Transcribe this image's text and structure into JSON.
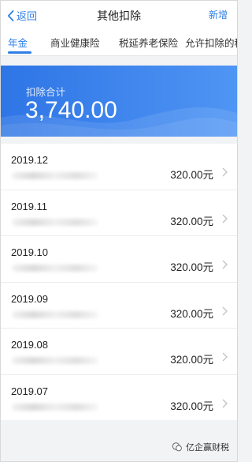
{
  "header": {
    "back_label": "返回",
    "title": "其他扣除",
    "add_label": "新增"
  },
  "tabs": [
    {
      "label": "年金"
    },
    {
      "label": "商业健康险"
    },
    {
      "label": "税延养老保险"
    },
    {
      "label": "允许扣除的税费"
    }
  ],
  "summary": {
    "label": "扣除合计",
    "total": "3,740.00"
  },
  "records": [
    {
      "period": "2019.12",
      "amount": "320.00元"
    },
    {
      "period": "2019.11",
      "amount": "320.00元"
    },
    {
      "period": "2019.10",
      "amount": "320.00元"
    },
    {
      "period": "2019.09",
      "amount": "320.00元"
    },
    {
      "period": "2019.08",
      "amount": "320.00元"
    },
    {
      "period": "2019.07",
      "amount": "320.00元"
    }
  ],
  "watermark": {
    "text": "亿企赢财税"
  },
  "colors": {
    "accent": "#2f7fe6",
    "banner_start": "#2e75e6",
    "banner_end": "#4f95f4"
  }
}
